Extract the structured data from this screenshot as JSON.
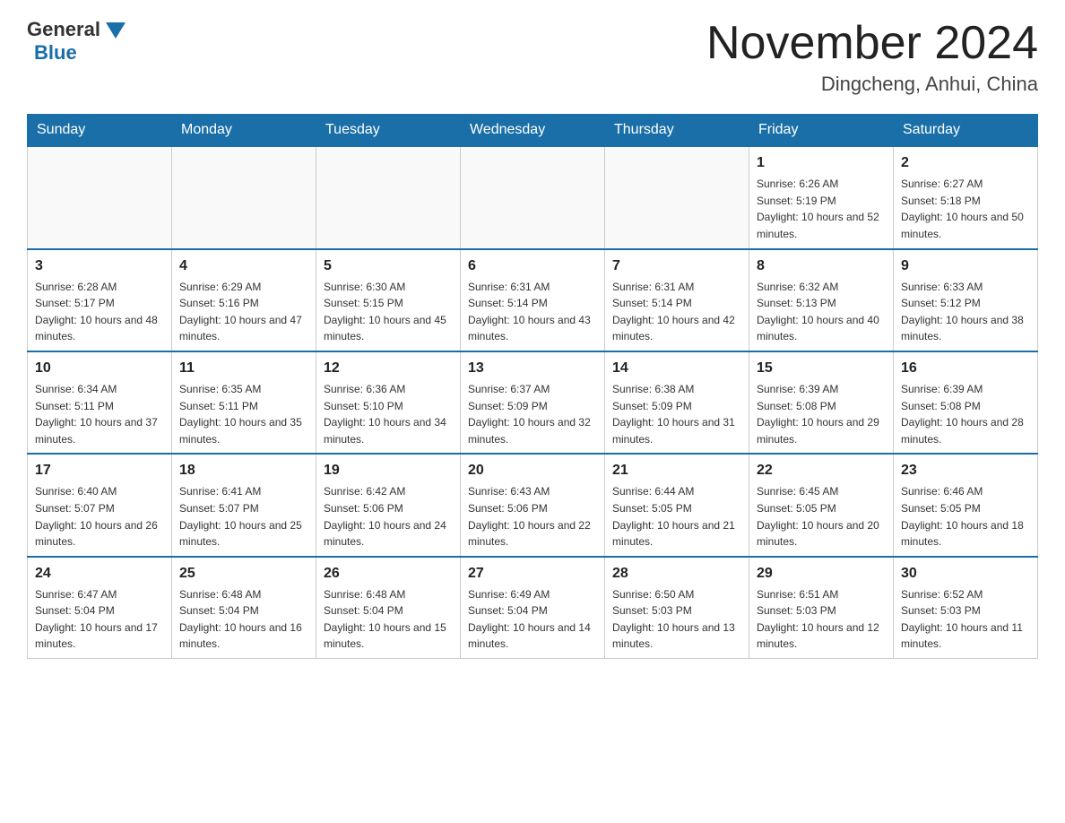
{
  "header": {
    "logo_general": "General",
    "logo_blue": "Blue",
    "month_title": "November 2024",
    "location": "Dingcheng, Anhui, China"
  },
  "weekdays": [
    "Sunday",
    "Monday",
    "Tuesday",
    "Wednesday",
    "Thursday",
    "Friday",
    "Saturday"
  ],
  "weeks": [
    [
      {
        "day": "",
        "info": ""
      },
      {
        "day": "",
        "info": ""
      },
      {
        "day": "",
        "info": ""
      },
      {
        "day": "",
        "info": ""
      },
      {
        "day": "",
        "info": ""
      },
      {
        "day": "1",
        "info": "Sunrise: 6:26 AM\nSunset: 5:19 PM\nDaylight: 10 hours and 52 minutes."
      },
      {
        "day": "2",
        "info": "Sunrise: 6:27 AM\nSunset: 5:18 PM\nDaylight: 10 hours and 50 minutes."
      }
    ],
    [
      {
        "day": "3",
        "info": "Sunrise: 6:28 AM\nSunset: 5:17 PM\nDaylight: 10 hours and 48 minutes."
      },
      {
        "day": "4",
        "info": "Sunrise: 6:29 AM\nSunset: 5:16 PM\nDaylight: 10 hours and 47 minutes."
      },
      {
        "day": "5",
        "info": "Sunrise: 6:30 AM\nSunset: 5:15 PM\nDaylight: 10 hours and 45 minutes."
      },
      {
        "day": "6",
        "info": "Sunrise: 6:31 AM\nSunset: 5:14 PM\nDaylight: 10 hours and 43 minutes."
      },
      {
        "day": "7",
        "info": "Sunrise: 6:31 AM\nSunset: 5:14 PM\nDaylight: 10 hours and 42 minutes."
      },
      {
        "day": "8",
        "info": "Sunrise: 6:32 AM\nSunset: 5:13 PM\nDaylight: 10 hours and 40 minutes."
      },
      {
        "day": "9",
        "info": "Sunrise: 6:33 AM\nSunset: 5:12 PM\nDaylight: 10 hours and 38 minutes."
      }
    ],
    [
      {
        "day": "10",
        "info": "Sunrise: 6:34 AM\nSunset: 5:11 PM\nDaylight: 10 hours and 37 minutes."
      },
      {
        "day": "11",
        "info": "Sunrise: 6:35 AM\nSunset: 5:11 PM\nDaylight: 10 hours and 35 minutes."
      },
      {
        "day": "12",
        "info": "Sunrise: 6:36 AM\nSunset: 5:10 PM\nDaylight: 10 hours and 34 minutes."
      },
      {
        "day": "13",
        "info": "Sunrise: 6:37 AM\nSunset: 5:09 PM\nDaylight: 10 hours and 32 minutes."
      },
      {
        "day": "14",
        "info": "Sunrise: 6:38 AM\nSunset: 5:09 PM\nDaylight: 10 hours and 31 minutes."
      },
      {
        "day": "15",
        "info": "Sunrise: 6:39 AM\nSunset: 5:08 PM\nDaylight: 10 hours and 29 minutes."
      },
      {
        "day": "16",
        "info": "Sunrise: 6:39 AM\nSunset: 5:08 PM\nDaylight: 10 hours and 28 minutes."
      }
    ],
    [
      {
        "day": "17",
        "info": "Sunrise: 6:40 AM\nSunset: 5:07 PM\nDaylight: 10 hours and 26 minutes."
      },
      {
        "day": "18",
        "info": "Sunrise: 6:41 AM\nSunset: 5:07 PM\nDaylight: 10 hours and 25 minutes."
      },
      {
        "day": "19",
        "info": "Sunrise: 6:42 AM\nSunset: 5:06 PM\nDaylight: 10 hours and 24 minutes."
      },
      {
        "day": "20",
        "info": "Sunrise: 6:43 AM\nSunset: 5:06 PM\nDaylight: 10 hours and 22 minutes."
      },
      {
        "day": "21",
        "info": "Sunrise: 6:44 AM\nSunset: 5:05 PM\nDaylight: 10 hours and 21 minutes."
      },
      {
        "day": "22",
        "info": "Sunrise: 6:45 AM\nSunset: 5:05 PM\nDaylight: 10 hours and 20 minutes."
      },
      {
        "day": "23",
        "info": "Sunrise: 6:46 AM\nSunset: 5:05 PM\nDaylight: 10 hours and 18 minutes."
      }
    ],
    [
      {
        "day": "24",
        "info": "Sunrise: 6:47 AM\nSunset: 5:04 PM\nDaylight: 10 hours and 17 minutes."
      },
      {
        "day": "25",
        "info": "Sunrise: 6:48 AM\nSunset: 5:04 PM\nDaylight: 10 hours and 16 minutes."
      },
      {
        "day": "26",
        "info": "Sunrise: 6:48 AM\nSunset: 5:04 PM\nDaylight: 10 hours and 15 minutes."
      },
      {
        "day": "27",
        "info": "Sunrise: 6:49 AM\nSunset: 5:04 PM\nDaylight: 10 hours and 14 minutes."
      },
      {
        "day": "28",
        "info": "Sunrise: 6:50 AM\nSunset: 5:03 PM\nDaylight: 10 hours and 13 minutes."
      },
      {
        "day": "29",
        "info": "Sunrise: 6:51 AM\nSunset: 5:03 PM\nDaylight: 10 hours and 12 minutes."
      },
      {
        "day": "30",
        "info": "Sunrise: 6:52 AM\nSunset: 5:03 PM\nDaylight: 10 hours and 11 minutes."
      }
    ]
  ]
}
